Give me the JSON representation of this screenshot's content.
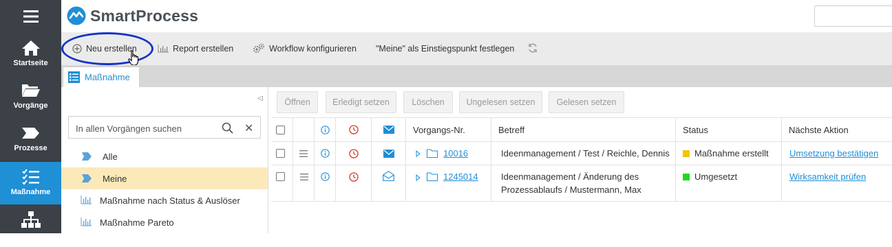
{
  "app": {
    "name": "SmartProcess"
  },
  "nav": {
    "items": [
      {
        "label": "Startseite",
        "icon": "home-icon"
      },
      {
        "label": "Vorgänge",
        "icon": "folder-open-icon"
      },
      {
        "label": "Prozesse",
        "icon": "process-arrow-icon"
      },
      {
        "label": "Maßnahme",
        "icon": "checklist-icon",
        "active": true
      },
      {
        "label": "",
        "icon": "org-chart-icon"
      }
    ]
  },
  "toolbar": {
    "new_label": "Neu erstellen",
    "report_label": "Report erstellen",
    "workflow_label": "Workflow konfigurieren",
    "entry_label": "\"Meine\" als Einstiegspunkt festlegen"
  },
  "tab": {
    "label": "Maßnahme"
  },
  "filter": {
    "search_placeholder": "In allen Vorgängen suchen",
    "items": [
      {
        "label": "Alle",
        "icon": "tag-icon"
      },
      {
        "label": "Meine",
        "icon": "tag-icon",
        "selected": true
      },
      {
        "label": "Maßnahme nach Status & Auslöser",
        "icon": "bar-chart-icon"
      },
      {
        "label": "Maßnahme Pareto",
        "icon": "bar-chart-icon"
      }
    ]
  },
  "actions": {
    "open": "Öffnen",
    "done": "Erledigt setzen",
    "delete": "Löschen",
    "unread": "Ungelesen setzen",
    "read": "Gelesen setzen"
  },
  "table": {
    "columns": {
      "number": "Vorgangs-Nr.",
      "subject": "Betreff",
      "status": "Status",
      "next": "Nächste Aktion"
    },
    "rows": [
      {
        "number": "10016",
        "subject": "Ideenmanagement / Test / Reichle, Dennis",
        "subject_line2": "",
        "status": "Maßnahme erstellt",
        "status_color": "#f5c400",
        "next": "Umsetzung bestätigen",
        "mail": "closed"
      },
      {
        "number": "1245014",
        "subject": "Ideenmanagement / Änderung des",
        "subject_line2": "Prozessablaufs / Mustermann, Max",
        "status": "Umgesetzt",
        "status_color": "#1ed91e",
        "next": "Wirksamkeit prüfen",
        "mail": "open"
      }
    ]
  },
  "colors": {
    "accent": "#1f8fd6",
    "nav_bg": "#3b4146",
    "highlight": "#1434c8",
    "selected_row": "#fbe9b9",
    "clock_red": "#d43a2a"
  }
}
